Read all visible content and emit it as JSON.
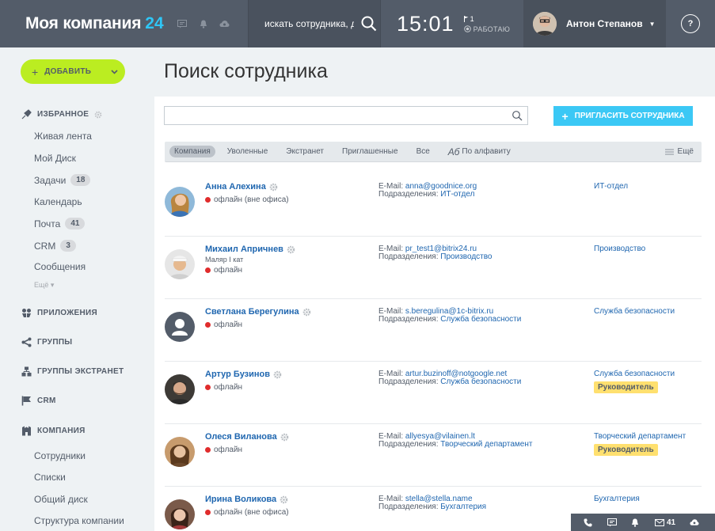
{
  "header": {
    "logo": "Моя компания",
    "logo_num": "24",
    "search_placeholder": "искать сотрудника, д",
    "time": "15:01",
    "flag_count": "1",
    "work_status": "РАБОТАЮ",
    "user_name": "Антон Степанов",
    "help": "?"
  },
  "sidebar": {
    "add_label": "ДОБАВИТЬ",
    "favorites_title": "ИЗБРАННОЕ",
    "favorites": [
      {
        "label": "Живая лента",
        "count": ""
      },
      {
        "label": "Мой Диск",
        "count": ""
      },
      {
        "label": "Задачи",
        "count": "18"
      },
      {
        "label": "Календарь",
        "count": ""
      },
      {
        "label": "Почта",
        "count": "41"
      },
      {
        "label": "CRM",
        "count": "3"
      },
      {
        "label": "Сообщения",
        "count": ""
      }
    ],
    "more": "Ещё",
    "sections": [
      "ПРИЛОЖЕНИЯ",
      "ГРУППЫ",
      "ГРУППЫ ЭКСТРАНЕТ",
      "CRM",
      "КОМПАНИЯ"
    ],
    "company_items": [
      "Сотрудники",
      "Списки",
      "Общий диск",
      "Структура компании"
    ]
  },
  "main": {
    "title": "Поиск сотрудника",
    "invite_label": "ПРИГЛАСИТЬ СОТРУДНИКА",
    "filters": [
      "Компания",
      "Уволенные",
      "Экстранет",
      "Приглашенные",
      "Все"
    ],
    "alpha_icon": "Аб",
    "alpha_label": "По алфавиту",
    "more_label": "Ещё",
    "email_label": "E-Mail:",
    "dept_label": "Подразделения:"
  },
  "employees": [
    {
      "name": "Анна Алехина",
      "position": "",
      "status": "офлайн (вне офиса)",
      "email": "anna@goodnice.org",
      "dept": "ИТ-отдел",
      "dept_col": "ИТ-отдел",
      "badge": ""
    },
    {
      "name": "Михаил Апричнев",
      "position": "Маляр I кат",
      "status": "офлайн",
      "email": "pr_test1@bitrix24.ru",
      "dept": "Производство",
      "dept_col": "Производство",
      "badge": ""
    },
    {
      "name": "Светлана Берегулина",
      "position": "",
      "status": "офлайн",
      "email": "s.beregulina@1c-bitrix.ru",
      "dept": "Служба безопасности",
      "dept_col": "Служба безопасности",
      "badge": ""
    },
    {
      "name": "Артур Бузинов",
      "position": "",
      "status": "офлайн",
      "email": "artur.buzinoff@notgoogle.net",
      "dept": "Служба безопасности",
      "dept_col": "Служба безопасности",
      "badge": "Руководитель"
    },
    {
      "name": "Олеся Виланова",
      "position": "",
      "status": "офлайн",
      "email": "allyesya@vilainen.lt",
      "dept": "Творческий департамент",
      "dept_col": "Творческий департамент",
      "badge": "Руководитель"
    },
    {
      "name": "Ирина Воликова",
      "position": "",
      "status": "офлайн (вне офиса)",
      "email": "stella@stella.name",
      "dept": "Бухгалтерия",
      "dept_col": "Бухгалтерия",
      "badge": ""
    }
  ],
  "bottom_bar": {
    "mail_count": "41"
  }
}
